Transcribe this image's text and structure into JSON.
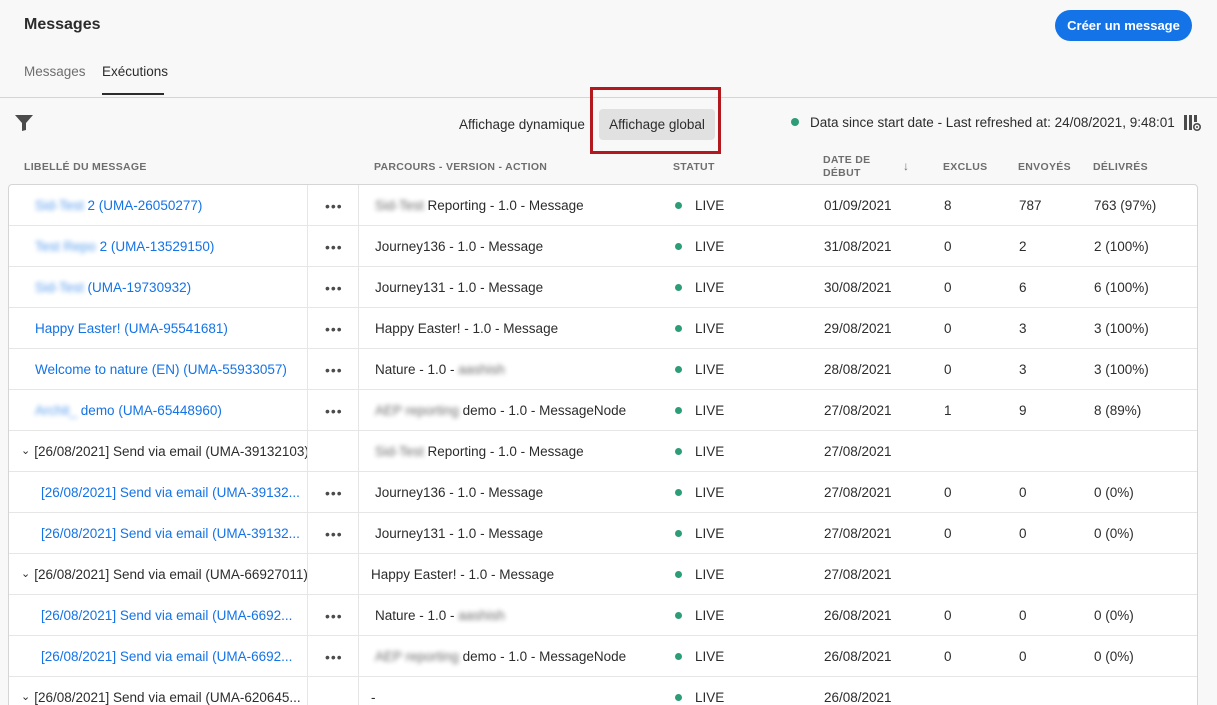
{
  "header": {
    "title": "Messages",
    "create_label": "Créer un message",
    "tabs": [
      "Messages",
      "Exécutions"
    ]
  },
  "toolbar": {
    "view_dynamic": "Affichage dynamique",
    "view_global": "Affichage global",
    "status_text": "Data since start date - Last refreshed at:  24/08/2021, 9:48:01"
  },
  "columns": {
    "label": "Libellé du message",
    "journey": "Parcours - version - action",
    "status": "Statut",
    "start_date_1": "Date de",
    "start_date_2": "début",
    "excluded": "Exclus",
    "sent": "Envoyés",
    "delivered": "Délivrés"
  },
  "rows": [
    {
      "label_blur": "Sid-Test",
      "label": "2 (UMA-26050277)",
      "journey_blur": "Sid-Test",
      "journey": "Reporting - 1.0 - Message",
      "status": "LIVE",
      "date": "01/09/2021",
      "excluded": "8",
      "sent": "787",
      "delivered": "763 (97%)"
    },
    {
      "label_blur": "Test Repo",
      "label": "2 (UMA-13529150)",
      "journey": "Journey136 - 1.0 - Message",
      "status": "LIVE",
      "date": "31/08/2021",
      "excluded": "0",
      "sent": "2",
      "delivered": "2 (100%)"
    },
    {
      "label_blur": "Sid-Test",
      "label": "(UMA-19730932)",
      "journey": "Journey131 - 1.0 - Message",
      "status": "LIVE",
      "date": "30/08/2021",
      "excluded": "0",
      "sent": "6",
      "delivered": "6 (100%)"
    },
    {
      "label": "Happy Easter! (UMA-95541681)",
      "journey": "Happy Easter! - 1.0 - Message",
      "status": "LIVE",
      "date": "29/08/2021",
      "excluded": "0",
      "sent": "3",
      "delivered": "3 (100%)"
    },
    {
      "label": "Welcome to nature (EN) (UMA-55933057)",
      "journey": "Nature - 1.0 -",
      "journey_tail_blur": "aashish",
      "status": "LIVE",
      "date": "28/08/2021",
      "excluded": "0",
      "sent": "3",
      "delivered": "3 (100%)"
    },
    {
      "label_blur": "Archit_",
      "label": "demo (UMA-65448960)",
      "journey_blur": "AEP reporting",
      "journey": "demo - 1.0 - MessageNode",
      "status": "LIVE",
      "date": "27/08/2021",
      "excluded": "1",
      "sent": "9",
      "delivered": "8 (89%)"
    },
    {
      "group": true,
      "label": "[26/08/2021] Send via email (UMA-39132103)",
      "journey_blur": "Sid-Test",
      "journey": "Reporting - 1.0 - Message",
      "status": "LIVE",
      "date": "27/08/2021"
    },
    {
      "child": true,
      "label": "[26/08/2021] Send via email (UMA-39132...",
      "journey": "Journey136 - 1.0 - Message",
      "status": "LIVE",
      "date": "27/08/2021",
      "excluded": "0",
      "sent": "0",
      "delivered": "0 (0%)"
    },
    {
      "child": true,
      "label": "[26/08/2021] Send via email (UMA-39132...",
      "journey": "Journey131 - 1.0 - Message",
      "status": "LIVE",
      "date": "27/08/2021",
      "excluded": "0",
      "sent": "0",
      "delivered": "0 (0%)"
    },
    {
      "group": true,
      "label": "[26/08/2021] Send via email (UMA-66927011)",
      "journey": "Happy Easter! - 1.0 - Message",
      "status": "LIVE",
      "date": "27/08/2021"
    },
    {
      "child": true,
      "label": "[26/08/2021] Send via email (UMA-6692...",
      "journey": "Nature - 1.0 -",
      "journey_tail_blur": "aashish",
      "status": "LIVE",
      "date": "26/08/2021",
      "excluded": "0",
      "sent": "0",
      "delivered": "0 (0%)"
    },
    {
      "child": true,
      "label": "[26/08/2021] Send via email (UMA-6692...",
      "journey_blur": "AEP reporting",
      "journey": "demo - 1.0 - MessageNode",
      "status": "LIVE",
      "date": "26/08/2021",
      "excluded": "0",
      "sent": "0",
      "delivered": "0 (0%)"
    },
    {
      "group": true,
      "label": "[26/08/2021] Send via email (UMA-620645...",
      "journey": "-",
      "status": "LIVE",
      "date": "26/08/2021"
    }
  ]
}
